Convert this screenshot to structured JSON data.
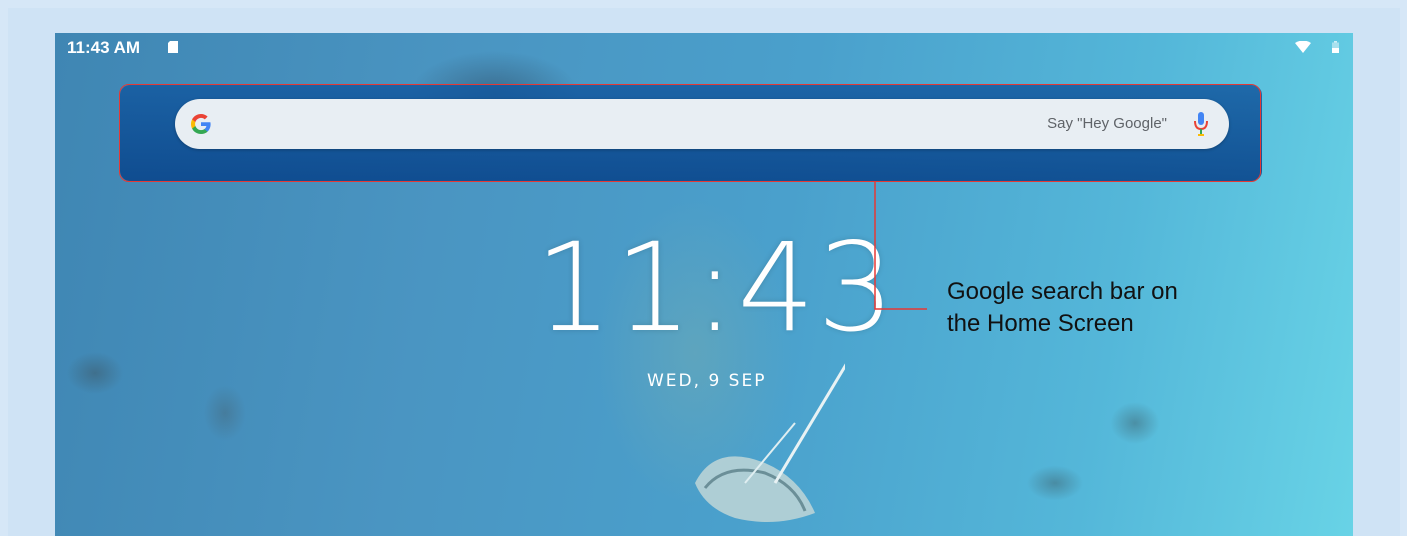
{
  "status_bar": {
    "time": "11:43 AM"
  },
  "search": {
    "hint": "Say \"Hey Google\"",
    "logo_letter": "G"
  },
  "lock_clock": {
    "time": "11:43",
    "date": "WED, 9 SEP"
  },
  "callout": {
    "line1": "Google search bar on",
    "line2": "the Home Screen",
    "color": "#e53935"
  },
  "colors": {
    "highlight": "#e53935",
    "google_blue": "#4285F4",
    "google_red": "#EA4335",
    "google_yellow": "#FBBC05",
    "google_green": "#34A853"
  },
  "icons": [
    "sd-card-icon",
    "wifi-icon",
    "battery-icon",
    "google-g-icon",
    "mic-icon"
  ]
}
